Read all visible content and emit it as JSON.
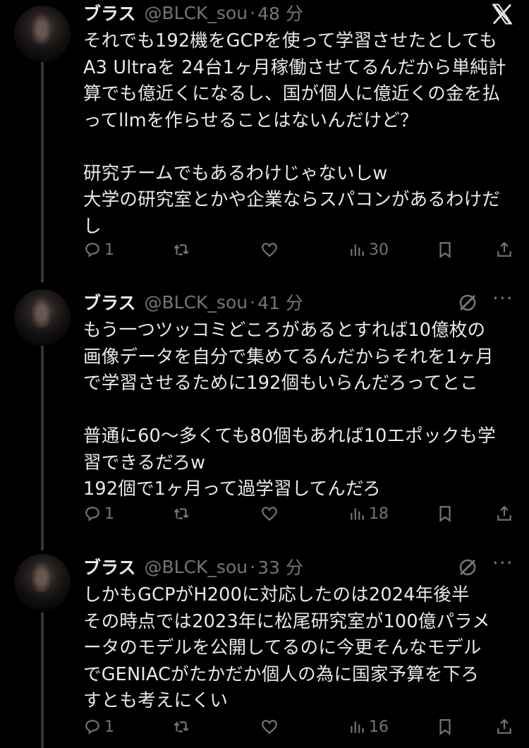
{
  "tweets": [
    {
      "name": "ブラス",
      "handle": "@BLCK_sou",
      "time": "48 分",
      "text": "それでも192機をGCPを使って学習させたとしても\nA3 Ultraを 24台1ヶ月稼働させてるんだから単純計\n算でも億近くになるし、国が個人に億近くの金を払\nってllmを作らせることはないんだけど？\n\n研究チームでもあるわけじゃないしw\n大学の研究室とかや企業ならスパコンがあるわけだ\nし",
      "replies": "1",
      "retweets": "",
      "likes": "",
      "views": "30"
    },
    {
      "name": "ブラス",
      "handle": "@BLCK_sou",
      "time": "41 分",
      "text": "もう一つツッコミどころがあるとすれば10億枚の\n画像データを自分で集めてるんだからそれを1ヶ月\nで学習させるために192個もいらんだろってとこ\n\n普通に60〜多くても80個もあれば10エポックも学\n習できるだろw\n192個で1ヶ月って過学習してんだろ",
      "replies": "1",
      "retweets": "",
      "likes": "",
      "views": "18"
    },
    {
      "name": "ブラス",
      "handle": "@BLCK_sou",
      "time": "33 分",
      "text": "しかもGCPがH200に対応したのは2024年後半\nその時点では2023年に松尾研究室が100億パラメ\nータのモデルを公開してるのに今更そんなモデル\nでGENIACがたかだか個人の為に国家予算を下ろ\nすとも考えにくい",
      "replies": "1",
      "retweets": "",
      "likes": "",
      "views": "16"
    }
  ],
  "icons": {
    "close": "x-logo-icon",
    "grok": "grok-icon",
    "more": "more-icon",
    "reply": "reply-icon",
    "retweet": "retweet-icon",
    "like": "heart-icon",
    "views": "views-icon",
    "bookmark": "bookmark-icon",
    "share": "share-icon"
  },
  "colors": {
    "background": "#000000",
    "text": "#e7e9ea",
    "secondary": "#71767b",
    "thread_line": "#333639"
  }
}
